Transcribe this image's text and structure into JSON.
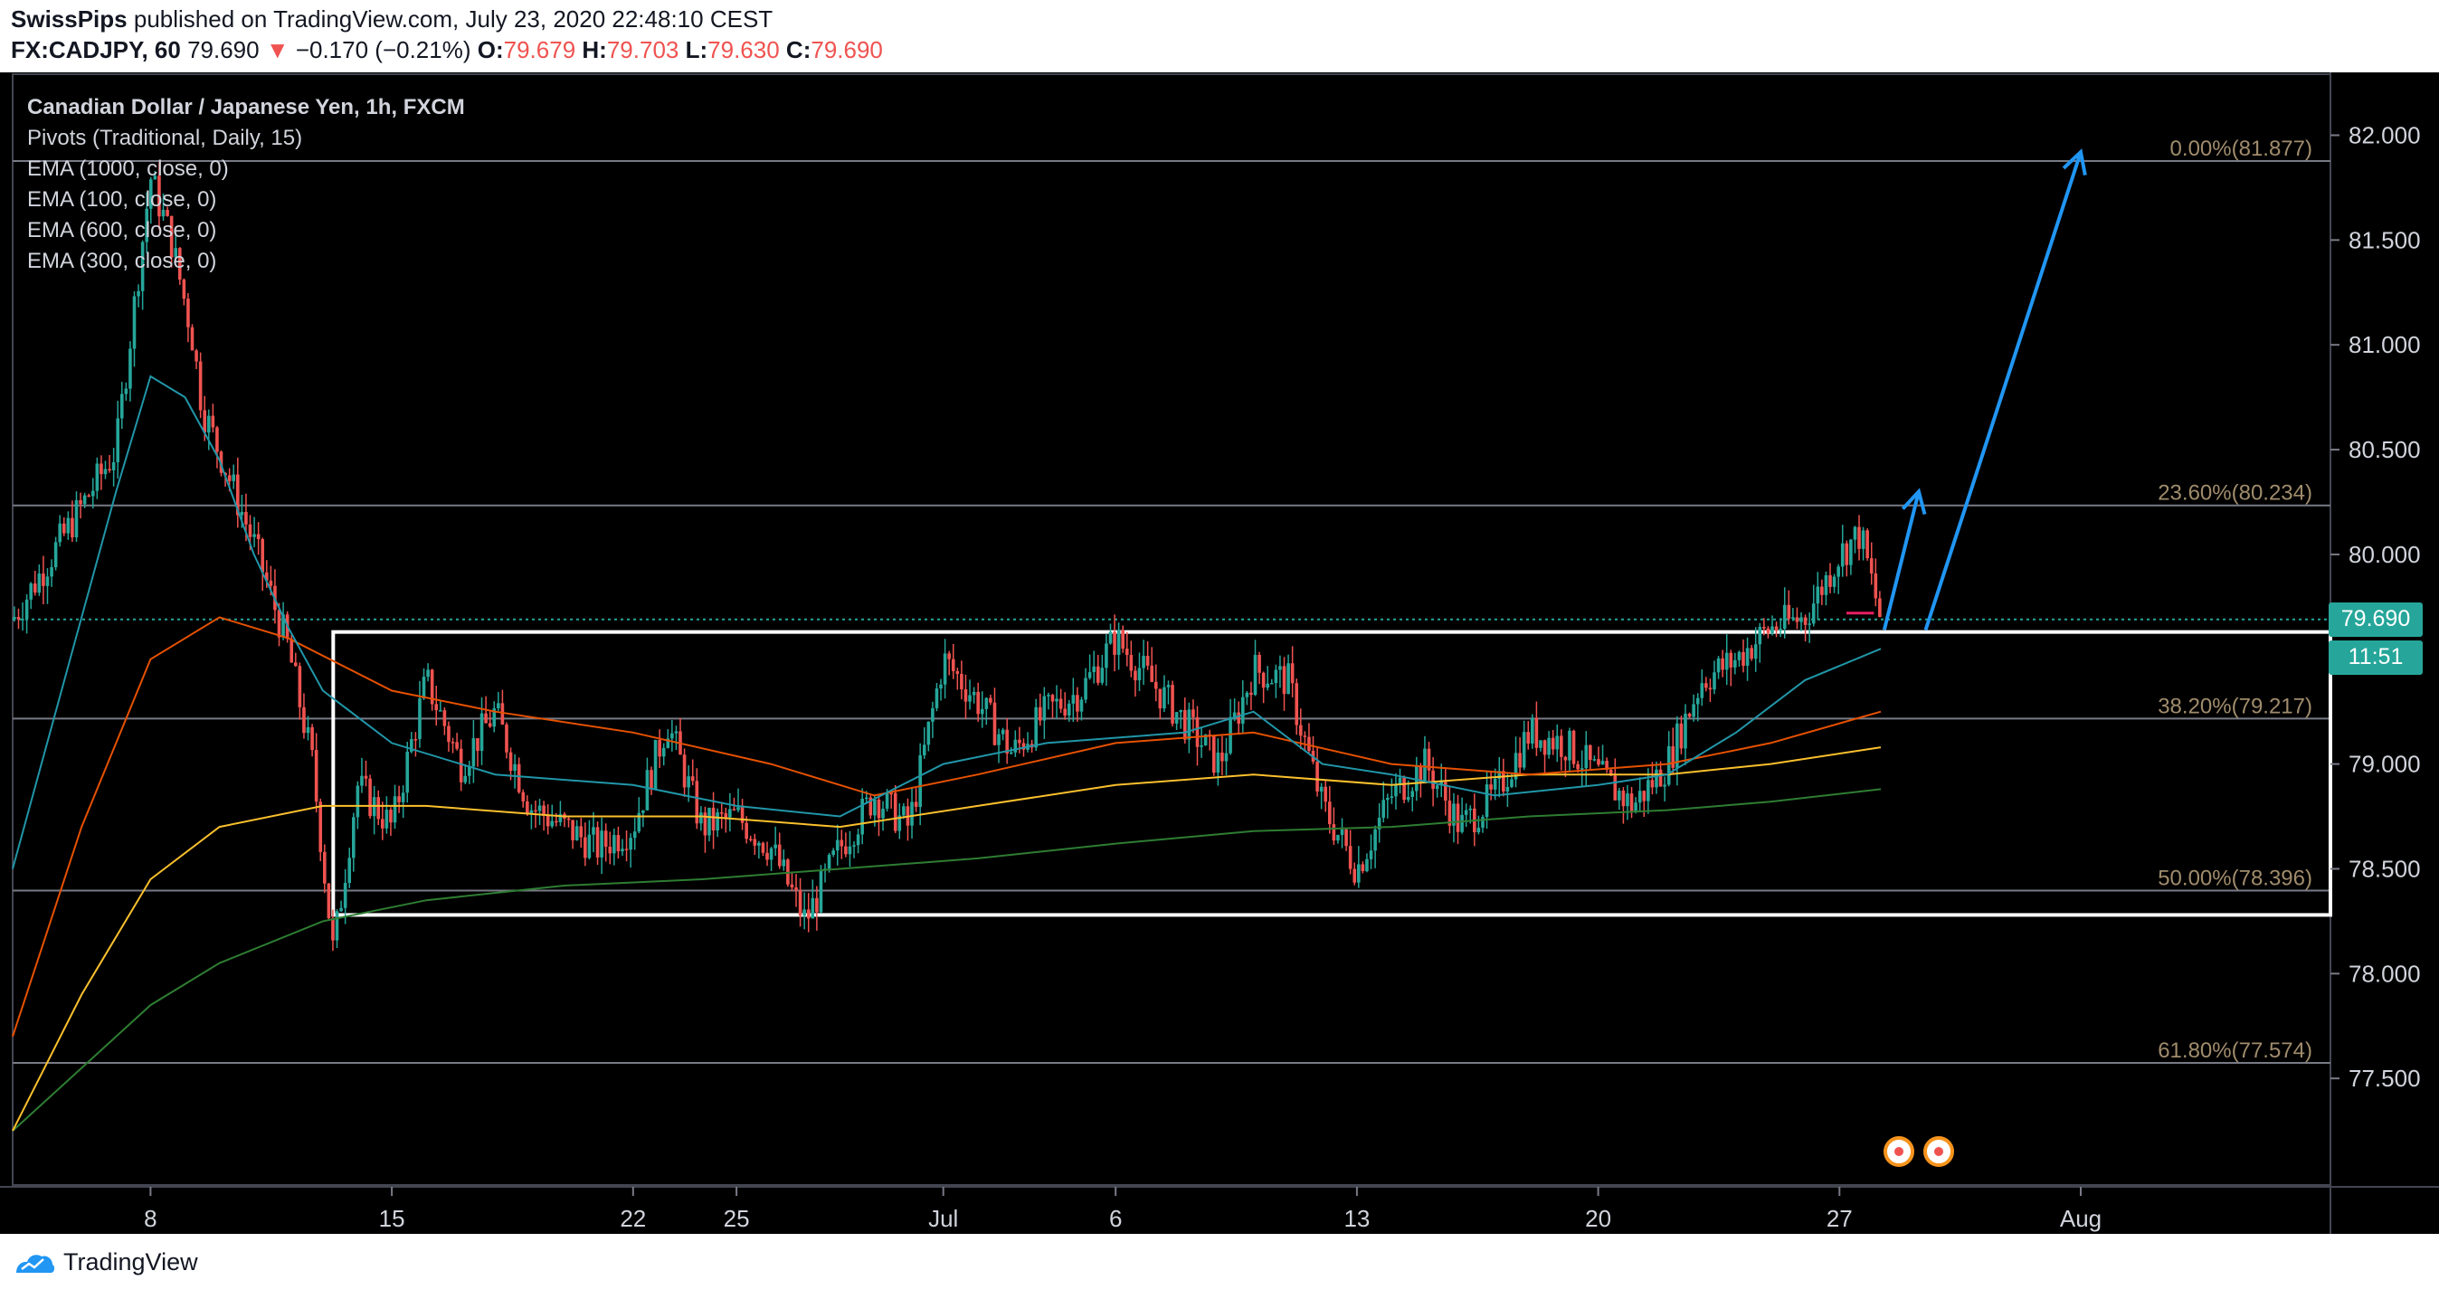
{
  "header": {
    "author": "SwissPips",
    "published": "published on TradingView.com, July 23, 2020 22:48:10 CEST",
    "symbol": "FX:CADJPY, 60",
    "last": "79.690",
    "change": "−0.170 (−0.21%)",
    "o_label": "O:",
    "o_value": "79.679",
    "h_label": "H:",
    "h_value": "79.703",
    "l_label": "L:",
    "l_value": "79.630",
    "c_label": "C:",
    "c_value": "79.690",
    "down_arrow": "▼"
  },
  "legend": {
    "title": "Canadian Dollar / Japanese Yen, 1h, FXCM",
    "indicators": [
      "Pivots (Traditional, Daily, 15)",
      "EMA (1000, close, 0)",
      "EMA (100, close, 0)",
      "EMA (600, close, 0)",
      "EMA (300, close, 0)"
    ]
  },
  "price_badge": "79.690",
  "time_badge": "11:51",
  "footer": {
    "brand": "TradingView"
  },
  "colors": {
    "up": "#26a69a",
    "down": "#ef5350",
    "fib": "#787b86",
    "ema_100": "#2196a8",
    "ema_300": "#e65100",
    "ema_600": "#fbc02d",
    "ema_1000": "#2e7d32",
    "arrow": "#2196f3",
    "box": "#ffffff"
  },
  "chart_data": {
    "type": "candlestick",
    "title": "Canadian Dollar / Japanese Yen, 1h, FXCM",
    "ylim": [
      77.0,
      82.3
    ],
    "y_ticks": [
      "82.000",
      "81.500",
      "81.000",
      "80.500",
      "80.000",
      "79.500",
      "79.000",
      "78.500",
      "78.000",
      "77.500"
    ],
    "x_ticks": [
      "8",
      "15",
      "22",
      "25",
      "Jul",
      "6",
      "13",
      "20",
      "27",
      "Aug"
    ],
    "fib_levels": [
      {
        "label": "0.00%(81.877)",
        "value": 81.877
      },
      {
        "label": "23.60%(80.234)",
        "value": 80.234
      },
      {
        "label": "38.20%(79.217)",
        "value": 79.217
      },
      {
        "label": "50.00%(78.396)",
        "value": 78.396
      },
      {
        "label": "61.80%(77.574)",
        "value": 77.574
      }
    ],
    "range_box": {
      "top": 79.63,
      "bottom": 78.28
    },
    "last_price": 79.69,
    "price_path": [
      [
        4,
        79.69
      ],
      [
        7,
        80.5
      ],
      [
        8,
        81.8
      ],
      [
        8.6,
        81.5
      ],
      [
        9.2,
        81.05
      ],
      [
        9.5,
        80.7
      ],
      [
        10.2,
        80.4
      ],
      [
        11,
        80.05
      ],
      [
        12,
        79.55
      ],
      [
        12.7,
        79.0
      ],
      [
        13.3,
        78.1
      ],
      [
        14,
        78.9
      ],
      [
        15,
        78.7
      ],
      [
        16,
        79.4
      ],
      [
        17,
        79.0
      ],
      [
        18,
        79.25
      ],
      [
        19,
        78.8
      ],
      [
        20,
        78.7
      ],
      [
        21,
        78.6
      ],
      [
        22,
        78.7
      ],
      [
        23,
        79.2
      ],
      [
        24,
        78.7
      ],
      [
        25,
        78.75
      ],
      [
        26,
        78.6
      ],
      [
        27,
        78.25
      ],
      [
        28,
        78.6
      ],
      [
        29,
        78.85
      ],
      [
        30,
        78.7
      ],
      [
        31,
        79.5
      ],
      [
        32,
        79.3
      ],
      [
        33,
        79.05
      ],
      [
        34,
        79.25
      ],
      [
        35,
        79.35
      ],
      [
        36,
        79.6
      ],
      [
        37,
        79.4
      ],
      [
        38,
        79.2
      ],
      [
        39,
        79.0
      ],
      [
        40,
        79.45
      ],
      [
        41,
        79.4
      ],
      [
        42,
        78.8
      ],
      [
        43,
        78.5
      ],
      [
        44,
        78.85
      ],
      [
        45,
        79.0
      ],
      [
        46,
        78.7
      ],
      [
        47,
        78.85
      ],
      [
        48,
        79.15
      ],
      [
        49,
        79.1
      ],
      [
        50,
        78.95
      ],
      [
        51,
        78.8
      ],
      [
        52,
        79.0
      ],
      [
        53,
        79.4
      ],
      [
        54,
        79.5
      ],
      [
        55,
        79.65
      ],
      [
        56,
        79.7
      ],
      [
        57,
        80.0
      ],
      [
        57.6,
        80.1
      ],
      [
        58.2,
        79.69
      ]
    ],
    "ema_100": [
      [
        4,
        78.5
      ],
      [
        6,
        79.7
      ],
      [
        7,
        80.3
      ],
      [
        8,
        80.85
      ],
      [
        9,
        80.75
      ],
      [
        10,
        80.45
      ],
      [
        11,
        80.0
      ],
      [
        12,
        79.65
      ],
      [
        13,
        79.35
      ],
      [
        15,
        79.1
      ],
      [
        18,
        78.95
      ],
      [
        22,
        78.9
      ],
      [
        25,
        78.8
      ],
      [
        28,
        78.75
      ],
      [
        31,
        79.0
      ],
      [
        34,
        79.1
      ],
      [
        38,
        79.15
      ],
      [
        40,
        79.25
      ],
      [
        42,
        79.0
      ],
      [
        44,
        78.95
      ],
      [
        47,
        78.85
      ],
      [
        50,
        78.9
      ],
      [
        52,
        78.95
      ],
      [
        54,
        79.15
      ],
      [
        56,
        79.4
      ],
      [
        58.2,
        79.55
      ]
    ],
    "ema_300": [
      [
        4,
        77.7
      ],
      [
        6,
        78.7
      ],
      [
        8,
        79.5
      ],
      [
        10,
        79.7
      ],
      [
        12,
        79.6
      ],
      [
        15,
        79.35
      ],
      [
        18,
        79.25
      ],
      [
        22,
        79.15
      ],
      [
        26,
        79.0
      ],
      [
        29,
        78.85
      ],
      [
        32,
        78.95
      ],
      [
        36,
        79.1
      ],
      [
        40,
        79.15
      ],
      [
        44,
        79.0
      ],
      [
        48,
        78.95
      ],
      [
        52,
        79.0
      ],
      [
        55,
        79.1
      ],
      [
        58.2,
        79.25
      ]
    ],
    "ema_600": [
      [
        4,
        77.25
      ],
      [
        6,
        77.9
      ],
      [
        8,
        78.45
      ],
      [
        10,
        78.7
      ],
      [
        13,
        78.8
      ],
      [
        16,
        78.8
      ],
      [
        20,
        78.75
      ],
      [
        24,
        78.75
      ],
      [
        28,
        78.7
      ],
      [
        32,
        78.8
      ],
      [
        36,
        78.9
      ],
      [
        40,
        78.95
      ],
      [
        44,
        78.9
      ],
      [
        48,
        78.95
      ],
      [
        52,
        78.95
      ],
      [
        55,
        79.0
      ],
      [
        58.2,
        79.08
      ]
    ],
    "ema_1000": [
      [
        4,
        77.25
      ],
      [
        6,
        77.55
      ],
      [
        8,
        77.85
      ],
      [
        10,
        78.05
      ],
      [
        13,
        78.25
      ],
      [
        16,
        78.35
      ],
      [
        20,
        78.42
      ],
      [
        24,
        78.45
      ],
      [
        28,
        78.5
      ],
      [
        32,
        78.55
      ],
      [
        36,
        78.62
      ],
      [
        40,
        78.68
      ],
      [
        44,
        78.7
      ],
      [
        48,
        78.75
      ],
      [
        52,
        78.78
      ],
      [
        55,
        78.82
      ],
      [
        58.2,
        78.88
      ]
    ],
    "projection_arrows": [
      {
        "from": [
          58.3,
          79.64
        ],
        "to": [
          59.3,
          80.3
        ]
      },
      {
        "from": [
          59.5,
          79.64
        ],
        "to": [
          64.0,
          81.92
        ]
      }
    ]
  }
}
